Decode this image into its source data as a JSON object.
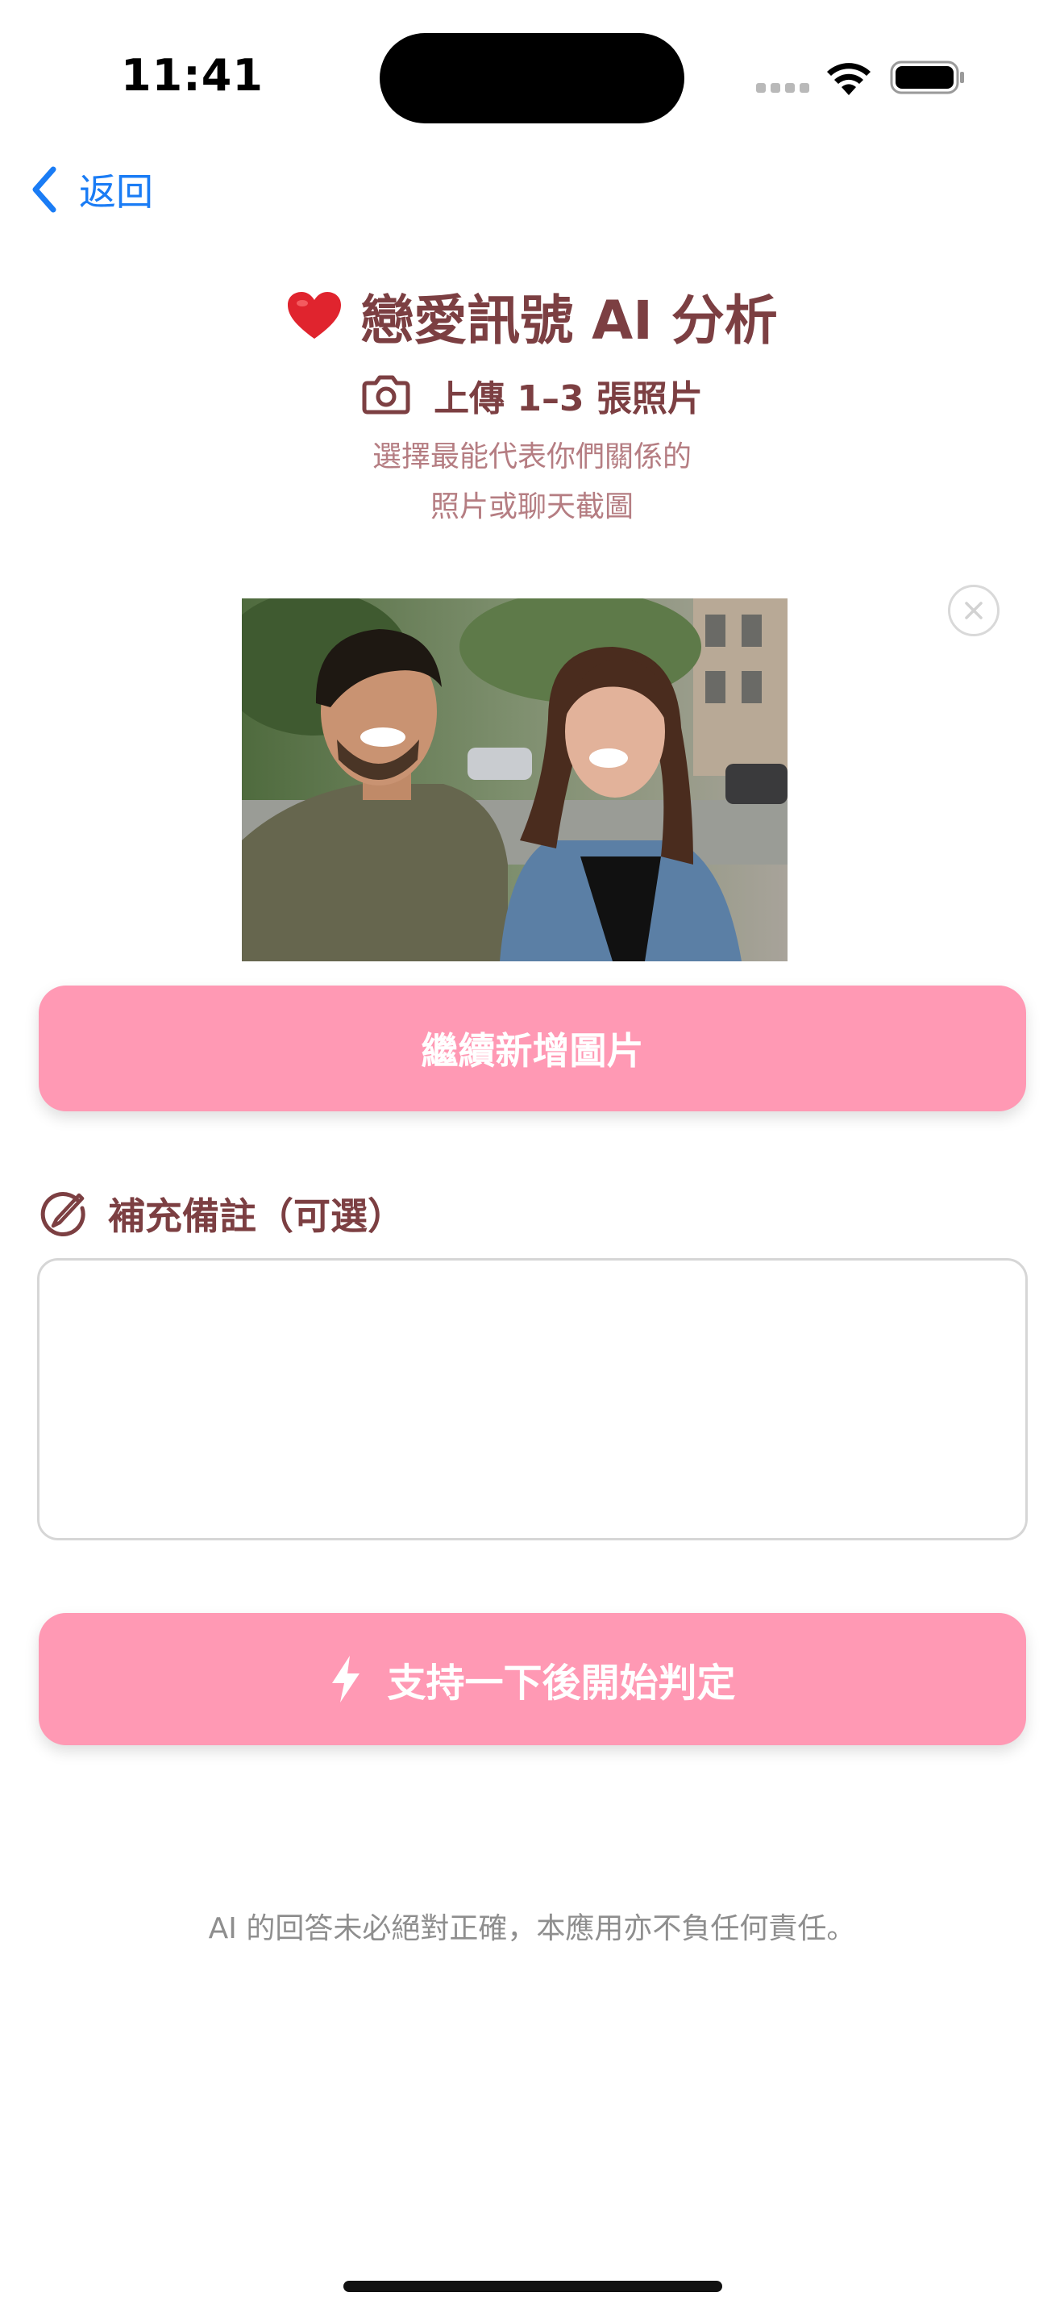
{
  "status_bar": {
    "time": "11:41"
  },
  "nav": {
    "back_label": "返回"
  },
  "header": {
    "title": "戀愛訊號 AI 分析",
    "subtitle": "上傳 1–3 張照片",
    "hint_line1": "選擇最能代表你們關係的",
    "hint_line2": "照片或聊天截圖"
  },
  "photos": [
    {
      "subject": "smiling couple photo"
    }
  ],
  "actions": {
    "add_more_label": "繼續新增圖片",
    "start_label": "支持一下後開始判定"
  },
  "notes": {
    "label": "補充備註（可選）",
    "value": "",
    "placeholder": ""
  },
  "footer": {
    "disclaimer": "AI 的回答未必絕對正確，本應用亦不負任何責任。"
  },
  "colors": {
    "accent_blue": "#1a7cf5",
    "button_pink": "#ff99b4",
    "heading_brown": "#7c3f42",
    "hint_pink": "#b57d82"
  },
  "icons": [
    "chevron-left-icon",
    "heart-icon",
    "camera-icon",
    "close-icon",
    "edit-icon",
    "bolt-icon",
    "wifi-icon",
    "battery-icon"
  ]
}
